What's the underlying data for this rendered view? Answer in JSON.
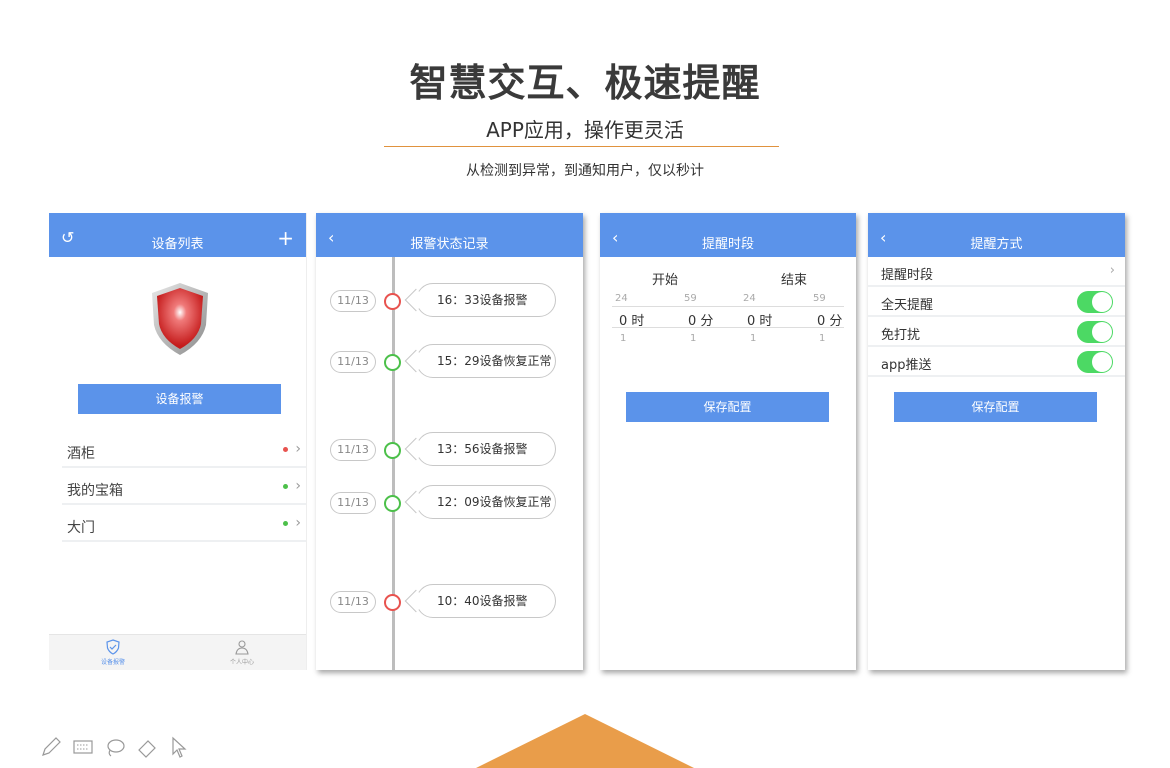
{
  "header": {
    "title": "智慧交互、极速提醒",
    "subtitle": "APP应用，操作更灵活",
    "description": "从检测到异常，到通知用户，仅以秒计"
  },
  "phone1": {
    "nav_title": "设备列表",
    "refresh_icon": "refresh-icon",
    "add_icon": "plus-icon",
    "alarm_button": "设备报警",
    "devices": [
      {
        "name": "酒柜",
        "status": "red"
      },
      {
        "name": "我的宝箱",
        "status": "green"
      },
      {
        "name": "大门",
        "status": "green"
      }
    ],
    "tabs": [
      {
        "label": "设备报警",
        "icon": "shield-check-icon"
      },
      {
        "label": "个人中心",
        "icon": "user-icon"
      }
    ]
  },
  "phone2": {
    "nav_title": "报警状态记录",
    "records": [
      {
        "date": "11/13",
        "text": "16：33设备报警",
        "status": "alarm"
      },
      {
        "date": "11/13",
        "text": "15：29设备恢复正常",
        "status": "normal"
      },
      {
        "date": "11/13",
        "text": "13：56设备报警",
        "status": "normal"
      },
      {
        "date": "11/13",
        "text": "12：09设备恢复正常",
        "status": "normal"
      },
      {
        "date": "11/13",
        "text": "10：40设备报警",
        "status": "alarm"
      }
    ]
  },
  "phone3": {
    "nav_title": "提醒时段",
    "start_label": "开始",
    "end_label": "结束",
    "picker": {
      "above": [
        "24",
        "59",
        "24",
        "59"
      ],
      "values": [
        "0",
        "0",
        "0",
        "0"
      ],
      "units": [
        "时",
        "分",
        "时",
        "分"
      ],
      "below": [
        "1",
        "1",
        "1",
        "1"
      ]
    },
    "save_button": "保存配置"
  },
  "phone4": {
    "nav_title": "提醒方式",
    "rows": [
      {
        "label": "提醒时段",
        "type": "link"
      },
      {
        "label": "全天提醒",
        "type": "toggle",
        "on": true
      },
      {
        "label": "免打扰",
        "type": "toggle",
        "on": true
      },
      {
        "label": "app推送",
        "type": "toggle",
        "on": true
      }
    ],
    "save_button": "保存配置"
  },
  "colors": {
    "nav_blue": "#5b93ea",
    "accent_orange": "#e99d4a",
    "alarm_red": "#e8534f",
    "normal_green": "#4cc04a",
    "toggle_green": "#4cd964"
  },
  "toolbar_icons": [
    "pen-icon",
    "keyboard-icon",
    "lasso-icon",
    "eraser-icon",
    "pointer-icon"
  ]
}
